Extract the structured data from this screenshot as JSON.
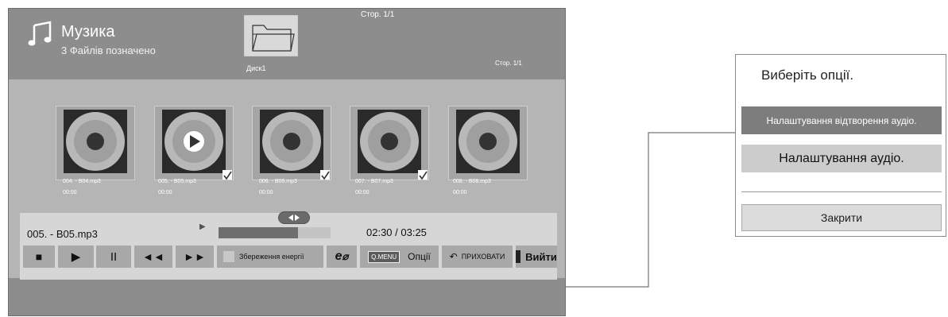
{
  "header": {
    "title": "Музика",
    "subtitle": "3 Файлів позначено",
    "top_page": "Стор. 1/1",
    "page_right": "Стор. 1/1"
  },
  "folder": {
    "label": "Диск1"
  },
  "thumbnails": [
    {
      "name": "004. - B04.mp3",
      "time": "00:00",
      "checked": false,
      "playing": false
    },
    {
      "name": "005. - B05.mp3",
      "time": "00:00",
      "checked": true,
      "playing": true
    },
    {
      "name": "006. - B06.mp3",
      "time": "00:00",
      "checked": true,
      "playing": false
    },
    {
      "name": "007. - B07.mp3",
      "time": "00:00",
      "checked": true,
      "playing": false
    },
    {
      "name": "008. - B08.mp3",
      "time": "00:00",
      "checked": false,
      "playing": false
    }
  ],
  "player": {
    "file": "005. - B05.mp3",
    "time": "02:30 / 03:25",
    "progress": 0.71
  },
  "controls": {
    "stop": "■",
    "play": "▶",
    "pause": "II",
    "rewind": "◄◄",
    "forward": "►►",
    "energy": "Збереження енергії",
    "eco": "e",
    "qmenu_key": "Q.MENU",
    "options": "Опції",
    "hide": "ПРИХОВАТИ",
    "exit": "Вийти"
  },
  "dialog": {
    "title": "Виберіть опції.",
    "option1": "Налаштування відтворення аудіо.",
    "option2": "Налаштування аудіо.",
    "close": "Закрити"
  }
}
